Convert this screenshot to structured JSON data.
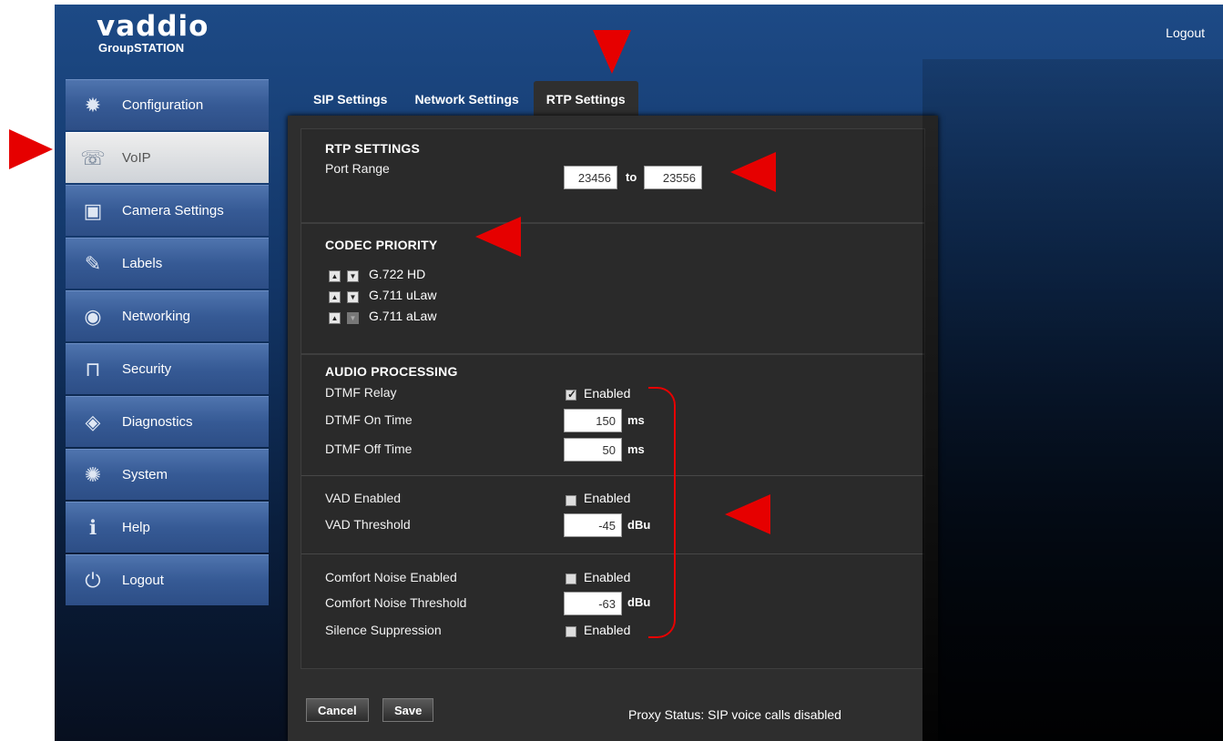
{
  "header": {
    "brand": "vaddio",
    "product": "GroupSTATION",
    "logout_label": "Logout"
  },
  "sidebar": {
    "items": [
      {
        "label": "Configuration",
        "icon": "gear-icon"
      },
      {
        "label": "VoIP",
        "icon": "phone-icon"
      },
      {
        "label": "Camera Settings",
        "icon": "camera-icon"
      },
      {
        "label": "Labels",
        "icon": "tag-icon"
      },
      {
        "label": "Networking",
        "icon": "network-icon"
      },
      {
        "label": "Security",
        "icon": "lock-icon"
      },
      {
        "label": "Diagnostics",
        "icon": "diagnostics-icon"
      },
      {
        "label": "System",
        "icon": "system-icon"
      },
      {
        "label": "Help",
        "icon": "help-icon"
      },
      {
        "label": "Logout",
        "icon": "power-icon"
      }
    ],
    "active": "VoIP"
  },
  "tabs": [
    {
      "label": "SIP Settings"
    },
    {
      "label": "Network Settings"
    },
    {
      "label": "RTP Settings"
    }
  ],
  "active_tab": "RTP Settings",
  "rtp": {
    "title": "RTP SETTINGS",
    "port_range_label": "Port Range",
    "port_start": "23456",
    "to_label": "to",
    "port_end": "23556"
  },
  "codec": {
    "title": "CODEC PRIORITY",
    "items": [
      "G.722 HD",
      "G.711 uLaw",
      "G.711 aLaw"
    ]
  },
  "audio": {
    "title": "AUDIO PROCESSING",
    "dtmf_relay_label": "DTMF Relay",
    "dtmf_relay_checked": true,
    "enabled_label": "Enabled",
    "dtmf_on_label": "DTMF On Time",
    "dtmf_on_value": "150",
    "dtmf_off_label": "DTMF Off Time",
    "dtmf_off_value": "50",
    "ms_unit": "ms",
    "vad_enabled_label": "VAD Enabled",
    "vad_enabled_checked": false,
    "vad_threshold_label": "VAD Threshold",
    "vad_threshold_value": "-45",
    "dbu_unit": "dBu",
    "comfort_noise_label": "Comfort Noise Enabled",
    "comfort_noise_checked": false,
    "comfort_threshold_label": "Comfort Noise Threshold",
    "comfort_threshold_value": "-63",
    "silence_suppression_label": "Silence Suppression",
    "silence_suppression_checked": false
  },
  "footer": {
    "cancel_label": "Cancel",
    "save_label": "Save",
    "proxy_status": "Proxy Status: SIP voice calls disabled"
  },
  "colors": {
    "annotation": "#e60000",
    "panel": "#2e2e2e",
    "nav": "#365a95",
    "nav_active": "#dcdcdc"
  }
}
